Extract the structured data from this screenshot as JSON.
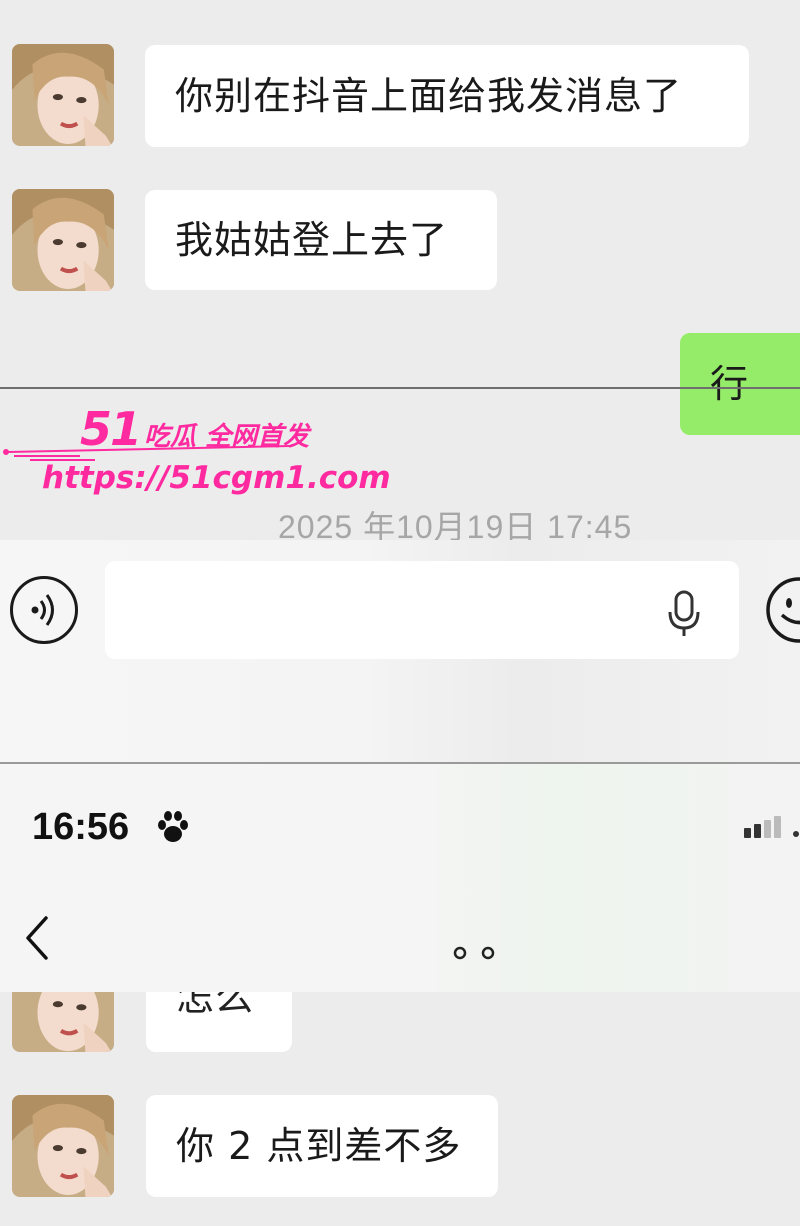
{
  "messages_top": [
    {
      "text": "你别在抖音上面给我发消息了",
      "side": "left"
    },
    {
      "text": "我姑姑登上去了",
      "side": "left"
    },
    {
      "text": "行",
      "side": "right"
    }
  ],
  "watermark": {
    "brand_number": "51",
    "brand_tag": "吃瓜 全网首发",
    "url": "https://51cgm1.com"
  },
  "timestamp": "2025 年10月19日 17:45",
  "input_bar": {
    "voice_icon": "voice-icon",
    "mic_icon": "microphone-icon",
    "emoji_icon": "emoji-icon"
  },
  "status_bar": {
    "time": "16:56",
    "time_icon": "paw-icon",
    "signal_icon": "signal-icon"
  },
  "nav": {
    "back_icon": "back-chevron-icon",
    "more_icon": "more-dots-icon"
  },
  "messages_bottom": [
    {
      "text": "怎么",
      "side": "left"
    },
    {
      "text": "你 2 点到差不多",
      "side": "left"
    }
  ],
  "colors": {
    "background": "#ececec",
    "bubble_left": "#ffffff",
    "bubble_right": "#95ec69",
    "watermark": "#ff2aa0",
    "timestamp": "#a6a6a6"
  }
}
